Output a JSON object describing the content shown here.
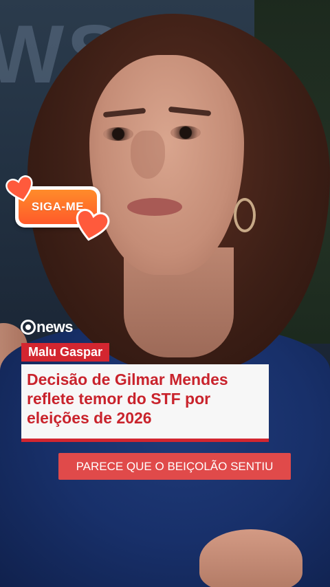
{
  "overlay": {
    "follow_sticker_label": "SIGA-ME",
    "follow_sticker_color": "#ff6a2a"
  },
  "broadcast": {
    "logo_text": "news",
    "logo_icon": "g-logo-icon",
    "reporter_name": "Malu Gaspar",
    "headline": "Decisão de Gilmar Mendes reflete temor do STF por eleições de 2026",
    "accent_color": "#d32630"
  },
  "caption": {
    "text": "PARECE QUE O BEIÇOLÃO SENTIU"
  }
}
